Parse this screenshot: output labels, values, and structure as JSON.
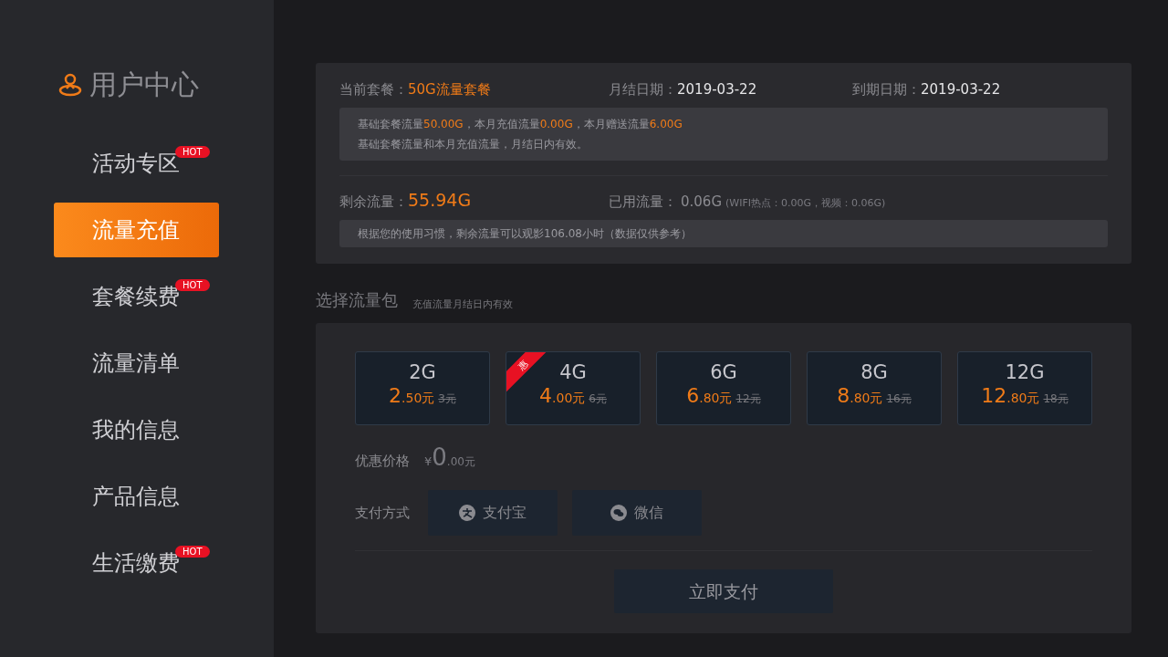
{
  "sidebar": {
    "title": "用户中心",
    "items": [
      {
        "label": "活动专区",
        "selected": false,
        "badge": "HOT"
      },
      {
        "label": "流量充值",
        "selected": true
      },
      {
        "label": "套餐续费",
        "selected": false,
        "badge": "HOT"
      },
      {
        "label": "流量清单",
        "selected": false
      },
      {
        "label": "我的信息",
        "selected": false
      },
      {
        "label": "产品信息",
        "selected": false
      },
      {
        "label": "生活缴费",
        "selected": false,
        "badge": "HOT"
      }
    ]
  },
  "plan": {
    "fields": [
      {
        "label": "当前套餐：",
        "value": "50G流量套餐",
        "highlight": true
      },
      {
        "label": "月结日期：",
        "value": "2019-03-22",
        "highlight": false
      },
      {
        "label": "到期日期：",
        "value": "2019-03-22",
        "highlight": false
      }
    ],
    "notes": [
      "基础套餐流量**50.00G**，本月充值流量**0.00G**，本月赠送流量**6.00G**",
      "基础套餐流量和本月充值流量，月结日内有效。"
    ]
  },
  "usage": {
    "remaining_label": "剩余流量：",
    "remaining": "55.94G",
    "used_label": "已用流量：",
    "used": "0.06G",
    "used_detail": "(WIFI热点：0.00G，视频：0.06G)",
    "note": "根据您的使用习惯，剩余流量可以观影106.08小时（数据仅供参考）"
  },
  "packages_section": {
    "title": "选择流量包",
    "subtitle": "充值流量月结日内有效"
  },
  "packages": [
    {
      "size": "2G",
      "price_main": "2",
      "price_sub": ".50元",
      "original": "3元",
      "selected": false
    },
    {
      "size": "4G",
      "price_main": "4",
      "price_sub": ".00元",
      "original": "6元",
      "selected": false,
      "ribbon": "惠"
    },
    {
      "size": "6G",
      "price_main": "6",
      "price_sub": ".80元",
      "original": "12元",
      "selected": false
    },
    {
      "size": "8G",
      "price_main": "8",
      "price_sub": ".80元",
      "original": "16元",
      "selected": false
    },
    {
      "size": "12G",
      "price_main": "12",
      "price_sub": ".80元",
      "original": "18元",
      "selected": false
    }
  ],
  "discount": {
    "label": "优惠价格",
    "currency": "¥",
    "main": "0",
    "sub": ".00元"
  },
  "payment": {
    "label": "支付方式",
    "methods": [
      {
        "kind": "alipay",
        "label": "支付宝",
        "selected": false
      },
      {
        "kind": "wechat",
        "label": "微信",
        "selected": false
      }
    ]
  },
  "pay_button": "立即支付"
}
